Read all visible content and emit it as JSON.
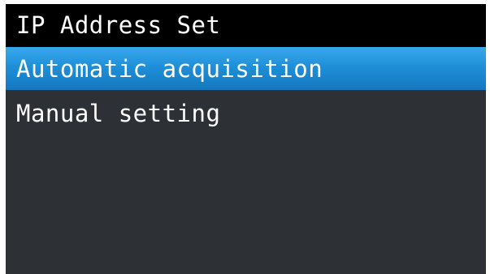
{
  "header": {
    "title": "IP Address Set"
  },
  "menu": {
    "selected_index": 0,
    "items": [
      {
        "label": "Automatic acquisition"
      },
      {
        "label": "Manual setting"
      }
    ]
  },
  "colors": {
    "screen_background": "#2d3034",
    "title_background": "#000000",
    "selection_highlight": "#1f8fd8",
    "text": "#ffffff"
  }
}
